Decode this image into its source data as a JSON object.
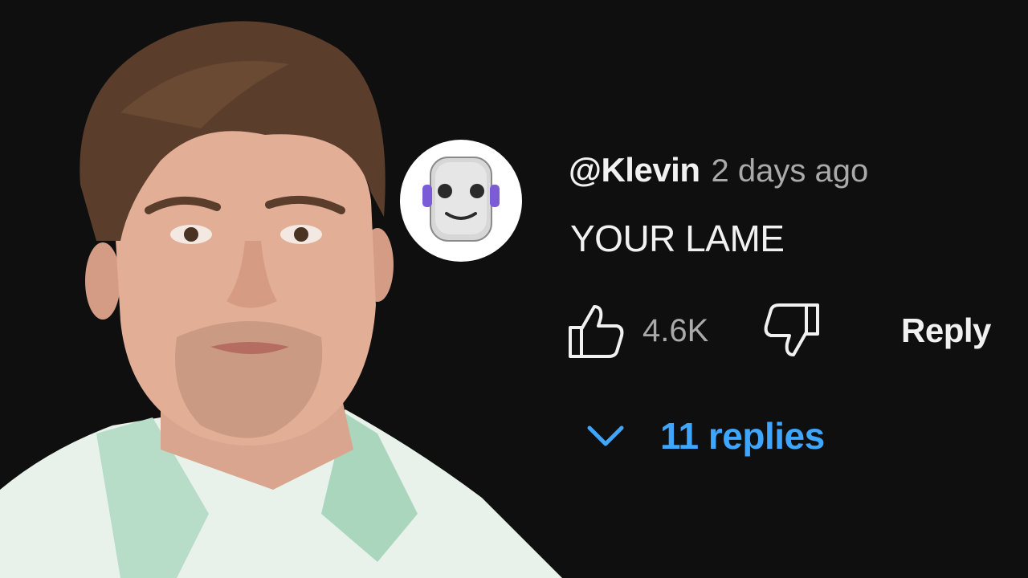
{
  "comment": {
    "handle": "@Klevin",
    "timestamp": "2 days ago",
    "text": "YOUR LAME",
    "avatar_icon": "robot-face-icon",
    "like_icon": "thumbs-up-icon",
    "like_count": "4.6K",
    "dislike_icon": "thumbs-down-icon",
    "reply_label": "Reply",
    "replies_icon": "chevron-down-icon",
    "replies_label": "11 replies"
  },
  "colors": {
    "background": "#0f0f0f",
    "text_primary": "#f1f1f1",
    "text_secondary": "#aaaaaa",
    "link_blue": "#3ea6ff",
    "avatar_accent": "#7b5cd6"
  }
}
